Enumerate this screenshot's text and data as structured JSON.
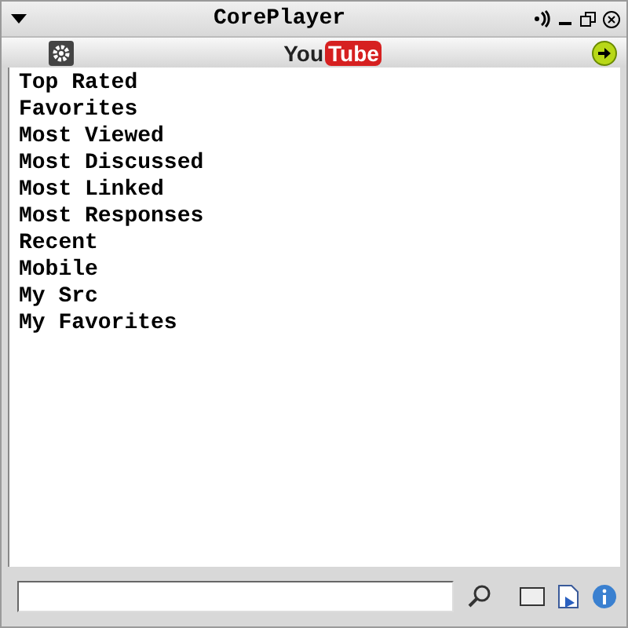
{
  "window": {
    "title": "CorePlayer"
  },
  "toolbar": {
    "logo": [
      "You",
      "Tube"
    ]
  },
  "menu": {
    "items": [
      {
        "label": "Top Rated"
      },
      {
        "label": "Favorites"
      },
      {
        "label": "Most Viewed"
      },
      {
        "label": "Most Discussed"
      },
      {
        "label": "Most Linked"
      },
      {
        "label": "Most Responses"
      },
      {
        "label": "Recent"
      },
      {
        "label": "Mobile"
      },
      {
        "label": "My Src"
      },
      {
        "label": "My Favorites"
      }
    ]
  }
}
